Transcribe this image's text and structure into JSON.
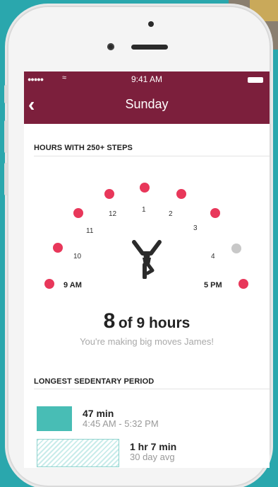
{
  "status_bar": {
    "signal": "●●●●●",
    "wifi": "≈",
    "time": "9:41 AM"
  },
  "nav": {
    "back_icon": "chevron-left",
    "title": "Sunday"
  },
  "hours_section": {
    "heading": "HOURS WITH 250+ STEPS",
    "hour_labels": [
      "9 AM",
      "10",
      "11",
      "12",
      "1",
      "2",
      "3",
      "4",
      "5 PM"
    ],
    "hour_states": [
      "active",
      "active",
      "active",
      "active",
      "active",
      "active",
      "active",
      "inactive",
      "active"
    ],
    "active_color": "#e8375a",
    "inactive_color": "#c8c8c8",
    "summary_number": "8",
    "summary_text": "of 9 hours",
    "message": "You're making big moves James!"
  },
  "sedentary_section": {
    "heading": "LONGEST SEDENTARY PERIOD",
    "entries": [
      {
        "value": "47 min",
        "detail": "4:45 AM - 5:32 PM"
      },
      {
        "value": "1 hr 7 min",
        "detail": "30 day avg"
      }
    ]
  },
  "colors": {
    "header": "#7c1f3c",
    "accent_teal": "#48bdb5",
    "background": "#2aa7ad"
  }
}
